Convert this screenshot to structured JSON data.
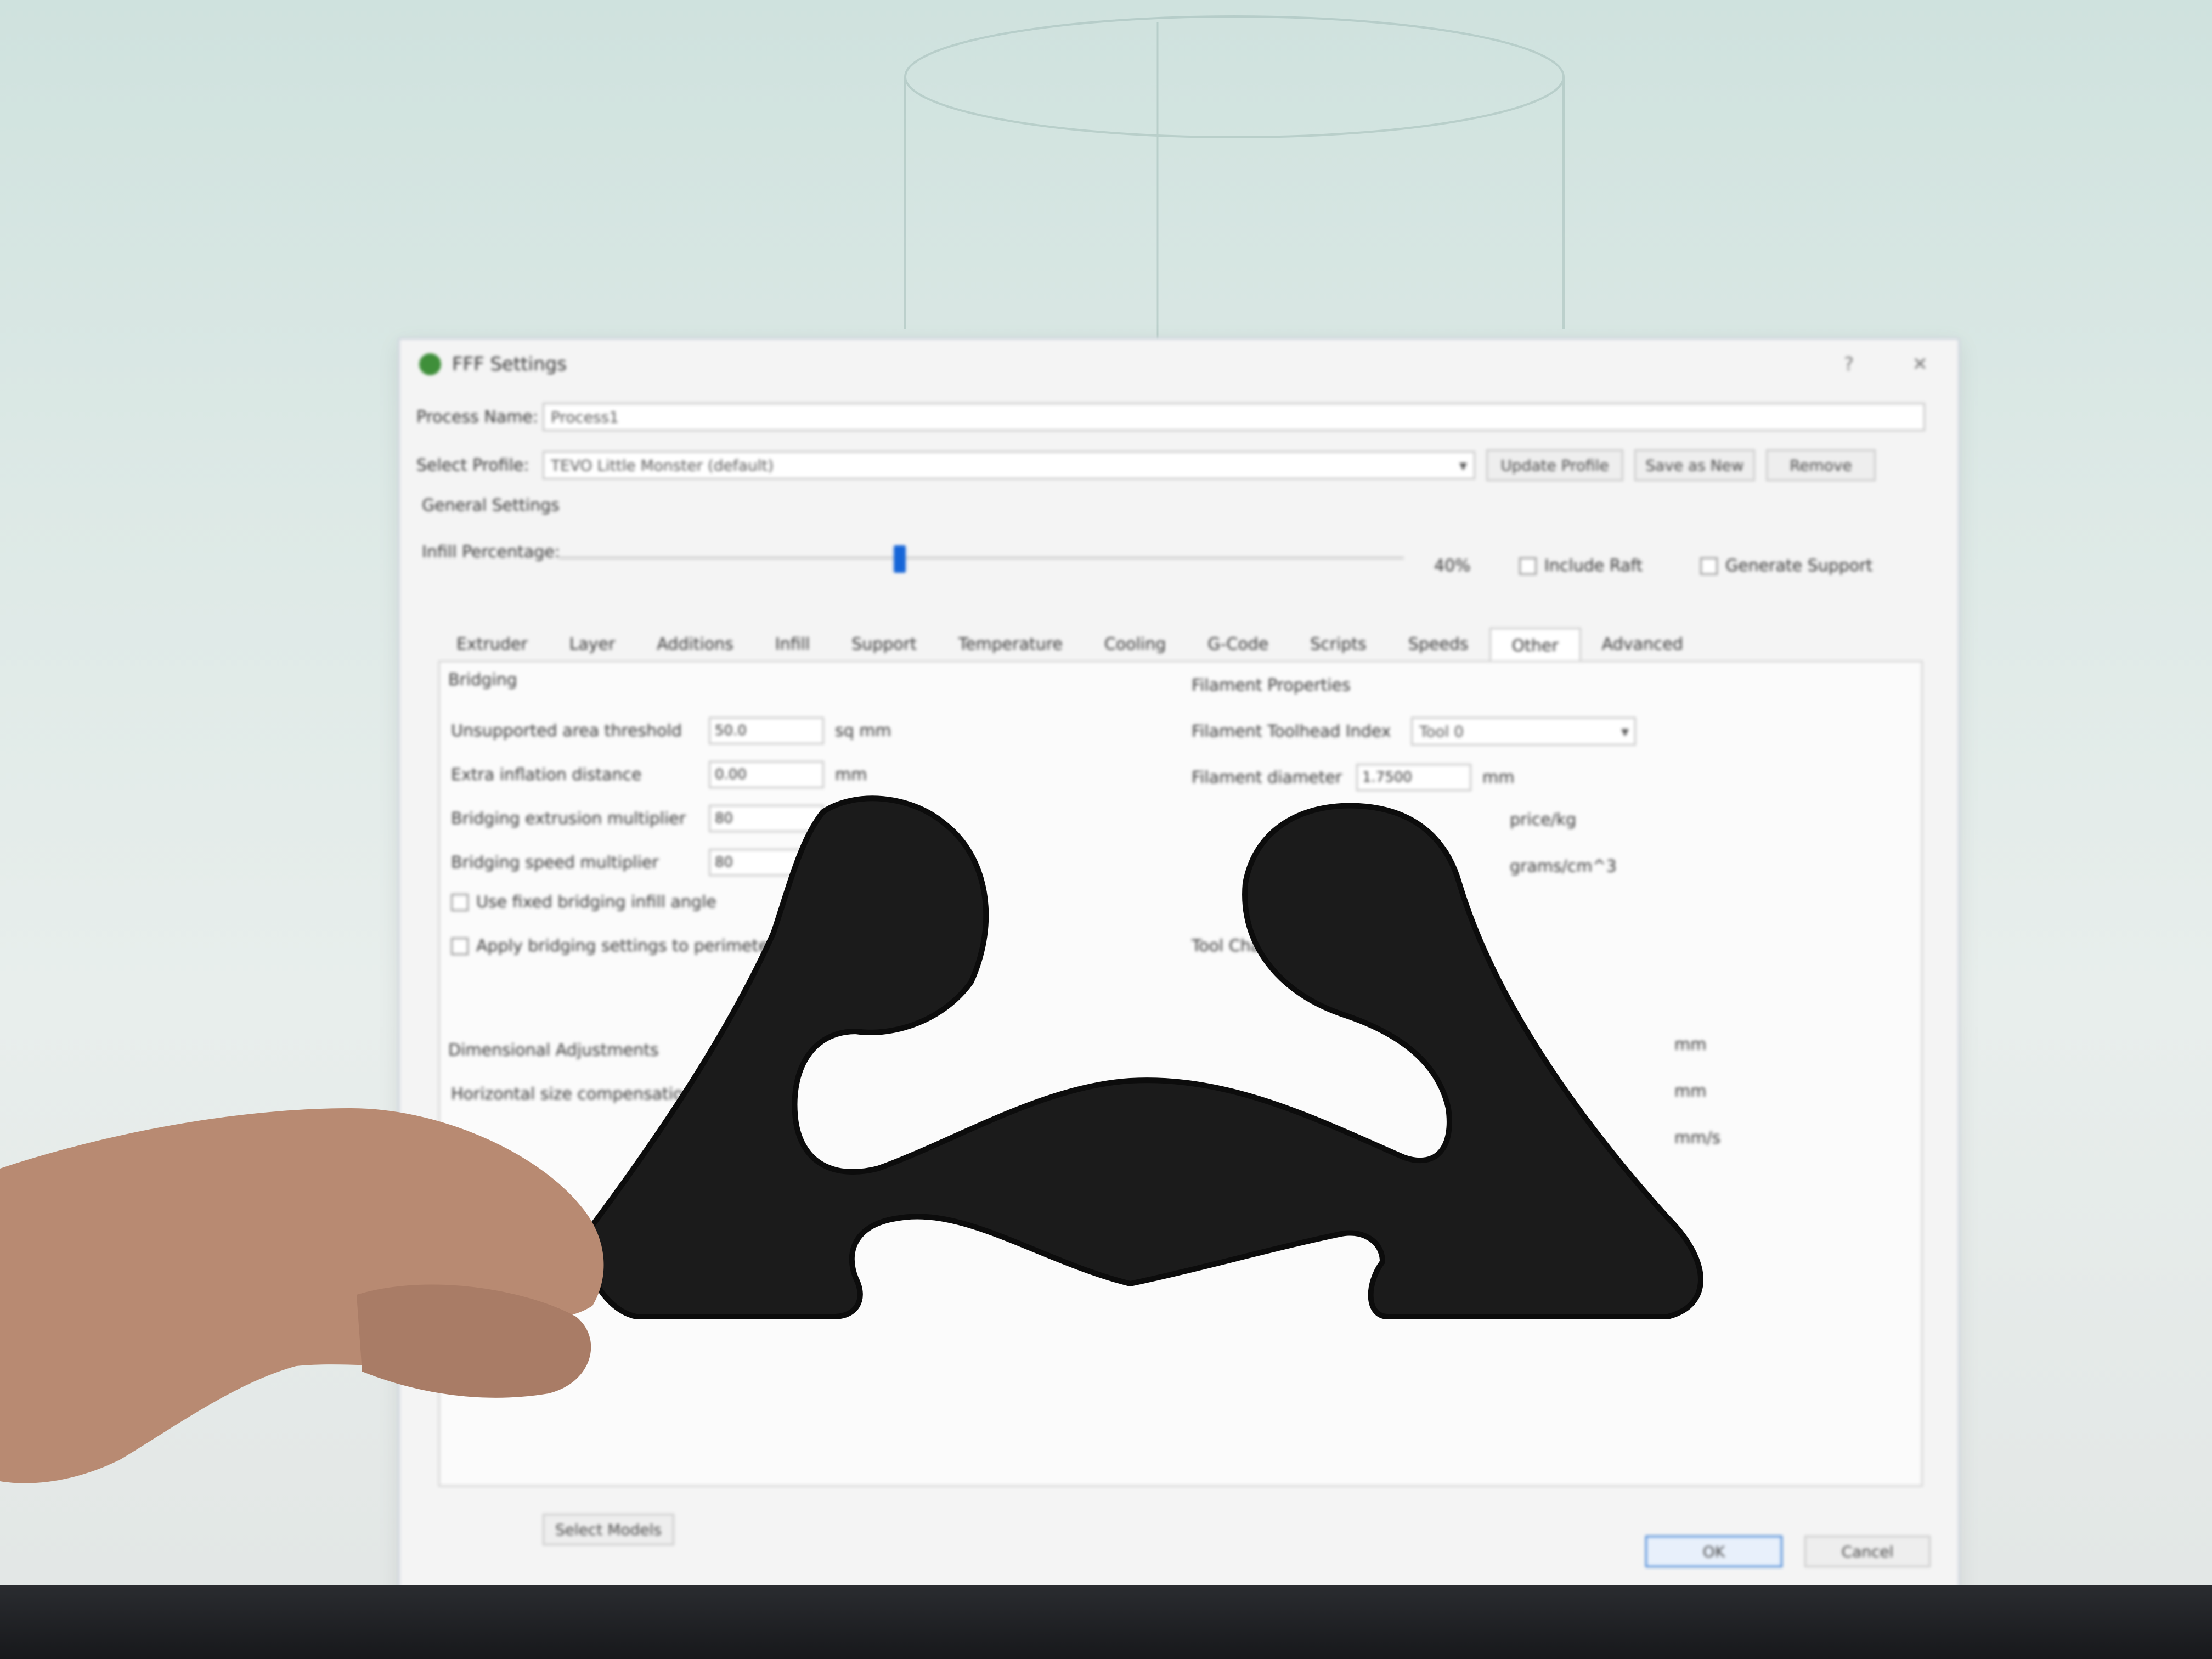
{
  "dialog": {
    "title": "FFF Settings",
    "process_name_label": "Process Name:",
    "process_name_value": "Process1",
    "select_profile_label": "Select Profile:",
    "select_profile_value": "TEVO Little Monster (default)",
    "update_profile_label": "Update Profile",
    "save_as_new_label": "Save as New",
    "remove_label": "Remove",
    "general_settings_label": "General Settings",
    "infill_percentage_label": "Infill Percentage:",
    "infill_percentage_value": "40%",
    "infill_fraction": 0.4,
    "include_raft_label": "Include Raft",
    "generate_support_label": "Generate Support",
    "tabs": [
      "Extruder",
      "Layer",
      "Additions",
      "Infill",
      "Support",
      "Temperature",
      "Cooling",
      "G-Code",
      "Scripts",
      "Speeds",
      "Other",
      "Advanced"
    ],
    "active_tab": "Other",
    "bridging": {
      "title": "Bridging",
      "rows": [
        {
          "label": "Unsupported area threshold",
          "value": "50.0",
          "unit": "sq mm"
        },
        {
          "label": "Extra inflation distance",
          "value": "0.00",
          "unit": "mm"
        },
        {
          "label": "Bridging extrusion multiplier",
          "value": "80",
          "unit": ""
        },
        {
          "label": "Bridging speed multiplier",
          "value": "80",
          "unit": ""
        }
      ],
      "use_fixed_angle_label": "Use fixed bridging infill angle",
      "apply_perimeters_label": "Apply bridging settings to perimeters"
    },
    "dimensional": {
      "title": "Dimensional Adjustments",
      "horizontal_size_label": "Horizontal size compensation"
    },
    "filament": {
      "title": "Filament Properties",
      "toolhead_label": "Filament Toolhead Index",
      "toolhead_value": "Tool 0",
      "diameter_label": "Filament diameter",
      "diameter_value": "1.7500",
      "diameter_unit": "mm",
      "price_unit": "price/kg",
      "density_unit": "grams/cm^3",
      "tool_change_label": "Tool Change",
      "retraction_unit": "mm",
      "extra_restart_unit": "mm",
      "retraction_speed_unit": "mm/s"
    },
    "select_models_label": "Select Models",
    "ok_label": "OK",
    "cancel_label": "Cancel"
  },
  "colors": {
    "object": "#1b1b1b",
    "accent": "#1565d8",
    "skin": "#c49a82"
  }
}
